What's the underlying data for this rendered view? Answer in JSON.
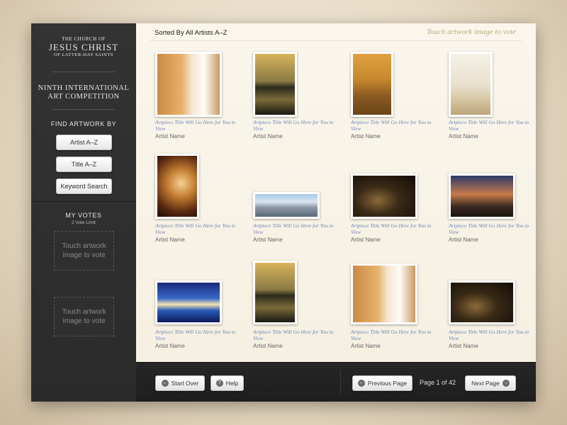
{
  "sidebar": {
    "logo": {
      "line1": "THE CHURCH OF",
      "line2": "JESUS CHRIST",
      "line3": "OF LATTER-DAY SAINTS"
    },
    "competition": {
      "line1": "NINTH INTERNATIONAL",
      "line2": "ART COMPETITION"
    },
    "find_label": "FIND ARTWORK BY",
    "buttons": [
      "Artist A–Z",
      "Title A–Z",
      "Keyword Search"
    ],
    "votes_label": "MY VOTES",
    "votes_limit": "2 Vote Limit",
    "vote_slots": [
      "Touch artwork image to vote",
      "Touch artwork image to vote"
    ]
  },
  "main": {
    "sorted_label": "Sorted By All Artists A–Z",
    "touch_hint": "Touch artwork image to vote",
    "artworks": [
      {
        "title": "Artpiece Title Will Go Here for You to View",
        "artist": "Artist Name",
        "image": "bride-photo"
      },
      {
        "title": "Artpiece Title Will Go Here for You to View",
        "artist": "Artist Name",
        "image": "temple-reflection"
      },
      {
        "title": "Artpiece Title Will Go Here for You to View",
        "artist": "Artist Name",
        "image": "desert-mosque"
      },
      {
        "title": "Artpiece Title Will Go Here for You to View",
        "artist": "Artist Name",
        "image": "white-temple"
      },
      {
        "title": "Artpiece Title Will Go Here for You to View",
        "artist": "Artist Name",
        "image": "candlelit-woman"
      },
      {
        "title": "Artpiece Title Will Go Here for You to View",
        "artist": "Artist Name",
        "image": "city-mountains"
      },
      {
        "title": "Artpiece Title Will Go Here for You to View",
        "artist": "Artist Name",
        "image": "arched-corridor"
      },
      {
        "title": "Artpiece Title Will Go Here for You to View",
        "artist": "Artist Name",
        "image": "wedding-couple"
      },
      {
        "title": "Artpiece Title Will Go Here for You to View",
        "artist": "Artist Name",
        "image": "night-temple-pool"
      },
      {
        "title": "Artpiece Title Will Go Here for You to View",
        "artist": "Artist Name",
        "image": "temple-reflection"
      },
      {
        "title": "Artpiece Title Will Go Here for You to View",
        "artist": "Artist Name",
        "image": "bride-photo"
      },
      {
        "title": "Artpiece Title Will Go Here for You to View",
        "artist": "Artist Name",
        "image": "arched-corridor"
      }
    ]
  },
  "bottombar": {
    "start_over": "Start Over",
    "help": "Help",
    "previous": "Previous Page",
    "page_indicator": "Page 1 of 42",
    "next": "Next Page"
  }
}
